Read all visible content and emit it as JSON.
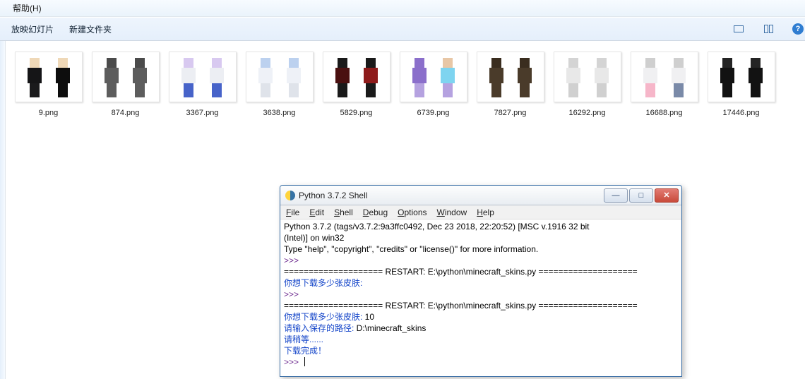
{
  "explorer": {
    "menu": {
      "help": "帮助(H)"
    },
    "toolbar": {
      "slideshow": "放映幻灯片",
      "newfolder": "新建文件夹"
    },
    "files": [
      {
        "name": "9.png",
        "left_class": "c-b1",
        "right_class": "c-b1b"
      },
      {
        "name": "874.png",
        "left_class": "c-gray",
        "right_class": "c-gray"
      },
      {
        "name": "3367.png",
        "left_class": "c-wh",
        "right_class": "c-wh"
      },
      {
        "name": "3638.png",
        "left_class": "c-wh2",
        "right_class": "c-wh2"
      },
      {
        "name": "5829.png",
        "left_class": "c-red",
        "right_class": "c-redb"
      },
      {
        "name": "6739.png",
        "left_class": "c-pur",
        "right_class": "c-glow"
      },
      {
        "name": "7827.png",
        "left_class": "c-brn",
        "right_class": "c-brn"
      },
      {
        "name": "16292.png",
        "left_class": "c-pnk",
        "right_class": "c-pnk"
      },
      {
        "name": "16688.png",
        "left_class": "c-pnk2",
        "right_class": "c-pnk2b"
      },
      {
        "name": "17446.png",
        "left_class": "c-blk",
        "right_class": "c-blk"
      }
    ]
  },
  "pyshell": {
    "title": "Python 3.7.2 Shell",
    "menus": [
      "File",
      "Edit",
      "Shell",
      "Debug",
      "Options",
      "Window",
      "Help"
    ],
    "banner1": "Python 3.7.2 (tags/v3.7.2:9a3ffc0492, Dec 23 2018, 22:20:52) [MSC v.1916 32 bit",
    "banner2": "(Intel)] on win32",
    "banner3": "Type \"help\", \"copyright\", \"credits\" or \"license()\" for more information.",
    "prompt": ">>>",
    "restart1": "==================== RESTART: E:\\python\\minecraft_skins.py ====================",
    "q1": "你想下载多少张皮肤:",
    "restart2": "==================== RESTART: E:\\python\\minecraft_skins.py ====================",
    "q2": "你想下载多少张皮肤: ",
    "a2": "10",
    "q3": "请输入保存的路径: ",
    "a3": "D:\\minecraft_skins",
    "wait": "请稍等......",
    "done": "下载完成！"
  }
}
